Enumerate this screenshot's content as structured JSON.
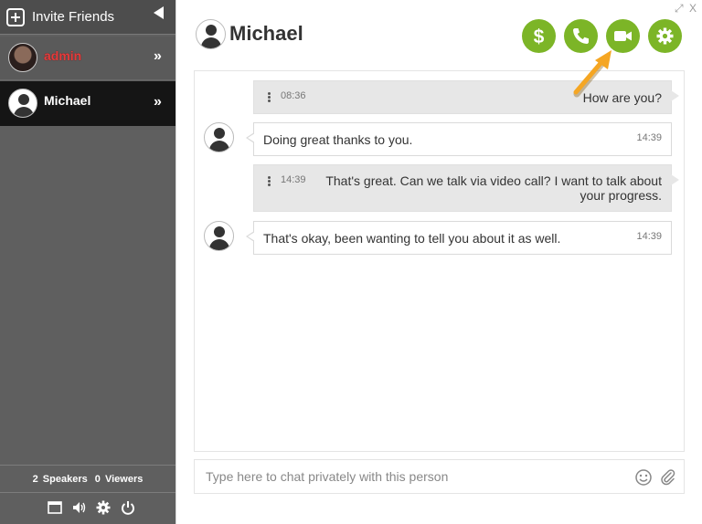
{
  "sidebar": {
    "invite_label": "Invite Friends",
    "users": [
      {
        "name": "admin"
      },
      {
        "name": "Michael"
      }
    ],
    "stats": {
      "speakers_count": "2",
      "speakers_label": "Speakers",
      "viewers_count": "0",
      "viewers_label": "Viewers"
    },
    "chevron": "»"
  },
  "chat": {
    "title": "Michael",
    "window_controls": {
      "expand": "⤢",
      "close": "X"
    },
    "messages": [
      {
        "direction": "out",
        "time": "08:36",
        "text": "How are you?"
      },
      {
        "direction": "in",
        "time": "14:39",
        "text": "Doing great thanks to you."
      },
      {
        "direction": "out",
        "time": "14:39",
        "text": "That's great. Can we talk via video call? I want to talk about your progress."
      },
      {
        "direction": "in",
        "time": "14:39",
        "text": "That's okay, been wanting to tell you about it as well."
      }
    ],
    "compose_placeholder": "Type here to chat privately with this person"
  },
  "actions": [
    "dollar-icon",
    "phone-icon",
    "video-camera-icon",
    "gear-icon"
  ],
  "colors": {
    "accent_green": "#7cb527",
    "annotation_arrow": "#f5a623",
    "admin_name": "#e53b3b"
  }
}
